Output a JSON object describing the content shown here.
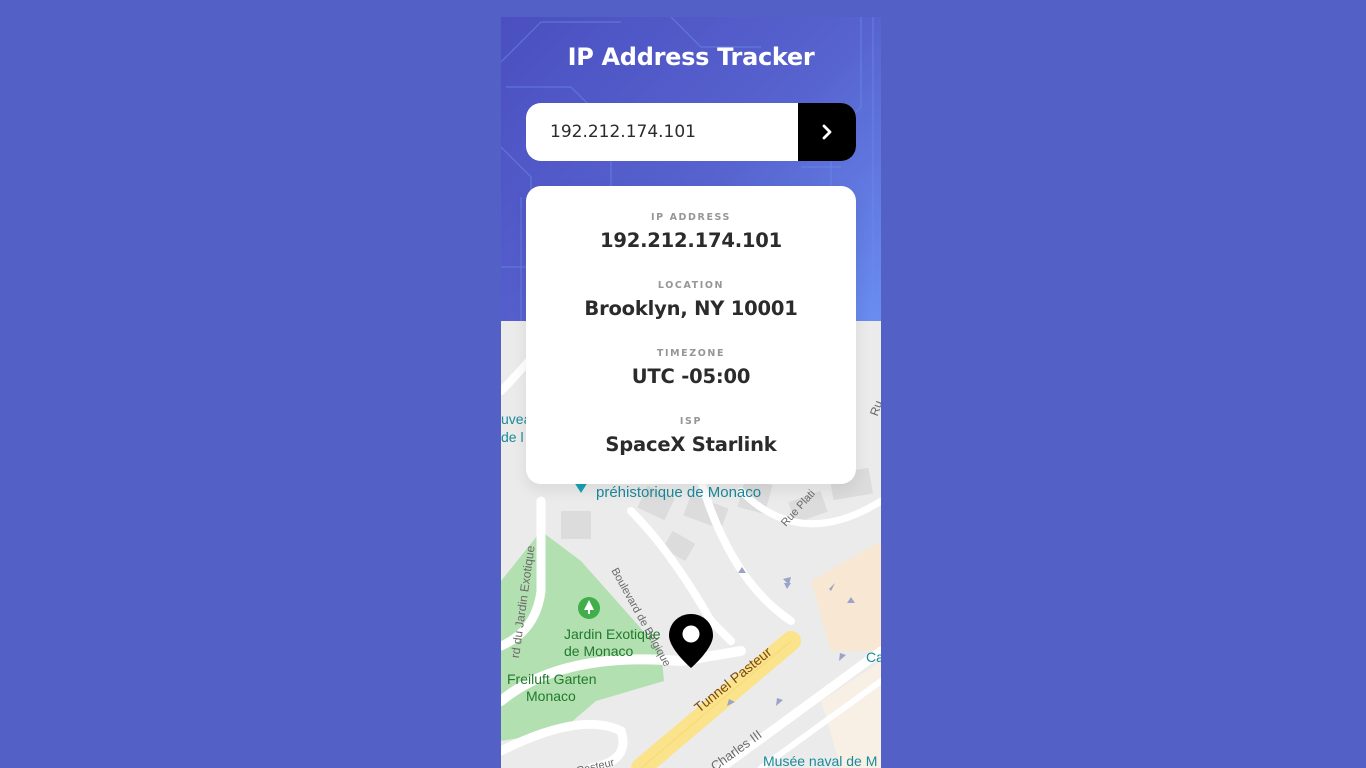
{
  "app": {
    "title": "IP Address Tracker"
  },
  "search": {
    "value": "192.212.174.101",
    "submit_icon": "chevron-right-icon"
  },
  "info": {
    "ip_label": "IP ADDRESS",
    "ip_value": "192.212.174.101",
    "location_label": "LOCATION",
    "location_value": "Brooklyn, NY 10001",
    "timezone_label": "TIMEZONE",
    "timezone_value": "UTC -05:00",
    "isp_label": "ISP",
    "isp_value": "SpaceX Starlink"
  },
  "map": {
    "labels": {
      "museum": "préhistorique de Monaco",
      "boulevard_belgique": "Boulevard de Belgique",
      "rue_plati": "Rue Plati",
      "bd_jardin": "rd du Jardin Exotique",
      "jardin_1": "Jardin Exotique",
      "jardin_2": "de Monaco",
      "freiluft_1": "Freiluft Garten",
      "freiluft_2": "Monaco",
      "tunnel": "Tunnel Pasteur",
      "pasteur": "e Pasteur",
      "charles": "e Charles III",
      "naval": "Musée naval de M",
      "nouveau_1": "uvea",
      "nouveau_2": "de l",
      "ru": "Ru",
      "ca": "Ca"
    },
    "marker_icon": "location-pin-icon"
  },
  "colors": {
    "background": "#5361c7",
    "header_start": "#4b4fc0",
    "header_end": "#6a8df0",
    "button": "#000000",
    "park": "#b3e0b0",
    "road_yellow": "#fbe38b"
  }
}
